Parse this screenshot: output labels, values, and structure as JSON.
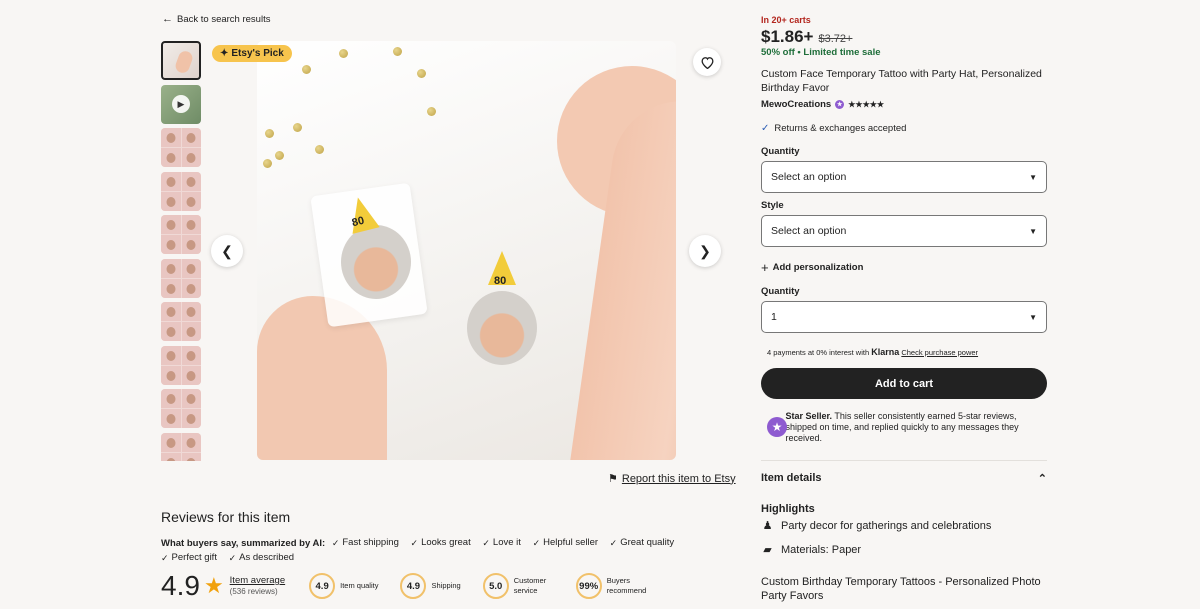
{
  "nav": {
    "back_label": "Back to search results"
  },
  "gallery": {
    "badge_label": "Etsy's Pick",
    "hat_number": "80",
    "thumbnails": [
      {
        "kind": "photo"
      },
      {
        "kind": "video"
      },
      {
        "kind": "grid"
      },
      {
        "kind": "grid"
      },
      {
        "kind": "grid"
      },
      {
        "kind": "grid"
      },
      {
        "kind": "grid"
      },
      {
        "kind": "grid"
      },
      {
        "kind": "grid"
      },
      {
        "kind": "grid"
      }
    ]
  },
  "report": {
    "label": "Report this item to Etsy"
  },
  "reviews": {
    "title": "Reviews for this item",
    "ai_label": "What buyers say, summarized by AI:",
    "ai_tags": [
      "Fast shipping",
      "Looks great",
      "Love it",
      "Helpful seller",
      "Great quality",
      "Perfect gift",
      "As described"
    ],
    "score": "4.9",
    "avg_label": "Item average",
    "avg_count": "(536 reviews)",
    "metrics": [
      {
        "value": "4.9",
        "label": "Item quality"
      },
      {
        "value": "4.9",
        "label": "Shipping"
      },
      {
        "value": "5.0",
        "label": "Customer service"
      },
      {
        "value": "99%",
        "label": "Buyers recommend"
      }
    ]
  },
  "product": {
    "in_carts": "In 20+ carts",
    "price": "$1.86+",
    "old_price": "$3.72+",
    "sale": "50% off",
    "sale_extra": "Limited time sale",
    "title": "Custom Face Temporary Tattoo with Party Hat, Personalized Birthday Favor",
    "seller": "MewoCreations",
    "seller_stars": "★★★★★",
    "returns": "Returns & exchanges accepted",
    "quantity_label_1": "Quantity",
    "quantity_select_1": "Select an option",
    "style_label": "Style",
    "style_select": "Select an option",
    "add_personalization": "Add personalization",
    "quantity_label_2": "Quantity",
    "quantity_value": "1",
    "klarna_text": "4 payments at 0% interest with",
    "klarna_brand": "Klarna",
    "klarna_link": "Check purchase power",
    "cart_label": "Add to cart",
    "star_seller_title": "Star Seller.",
    "star_seller_text": "This seller consistently earned 5-star reviews, shipped on time, and replied quickly to any messages they received.",
    "item_details": "Item details",
    "highlights_title": "Highlights",
    "highlight_1": "Party decor for gatherings and celebrations",
    "highlight_2": "Materials: Paper",
    "description": "Custom Birthday Temporary Tattoos - Personalized Photo Party Favors"
  },
  "colors": {
    "accent_sale": "#1f6e3a",
    "in_carts": "#b3261e",
    "badge": "#f7c44d",
    "cart_button": "#222222",
    "star_seller": "#8e5bd0",
    "rating_star": "#f1a10d"
  }
}
